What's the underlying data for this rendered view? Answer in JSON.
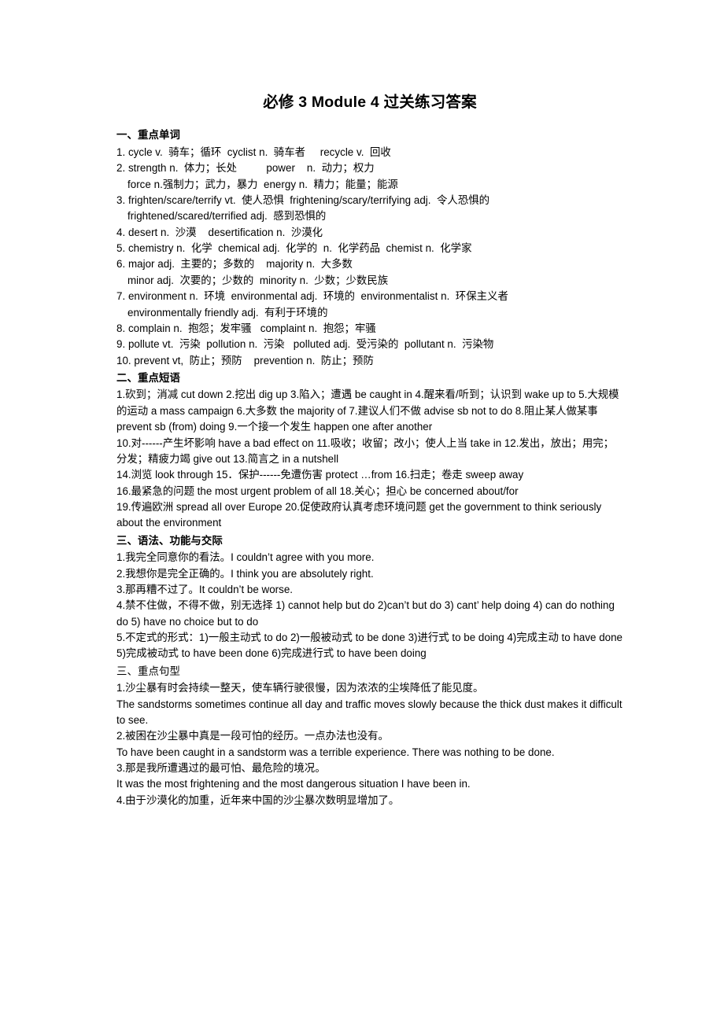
{
  "document": {
    "title": "必修 3 Module 4  过关练习答案"
  },
  "sections": [
    {
      "id": "key-words",
      "heading": "一、重点单词",
      "heading_bold": true,
      "lines": [
        {
          "indent": false,
          "text": "1. cycle v.  骑车；循环  cyclist n.  骑车者     recycle v.  回收"
        },
        {
          "indent": false,
          "text": "2. strength n.  体力；长处          power    n.  动力；权力"
        },
        {
          "indent": true,
          "text": "force n.强制力；武力，暴力  energy n.  精力；能量；能源"
        },
        {
          "indent": false,
          "text": "3. frighten/scare/terrify vt.  使人恐惧  frightening/scary/terrifying adj.  令人恐惧的"
        },
        {
          "indent": true,
          "text": "frightened/scared/terrified adj.  感到恐惧的"
        },
        {
          "indent": false,
          "text": "4. desert n.  沙漠    desertification n.  沙漠化"
        },
        {
          "indent": false,
          "text": "5. chemistry n.  化学  chemical adj.  化学的  n.  化学药品  chemist n.  化学家"
        },
        {
          "indent": false,
          "text": "6. major adj.  主要的；多数的    majority n.  大多数"
        },
        {
          "indent": true,
          "text": "minor adj.  次要的；少数的  minority n.  少数；少数民族"
        },
        {
          "indent": false,
          "text": "7. environment n.  环境  environmental adj.  环境的  environmentalist n.  环保主义者"
        },
        {
          "indent": true,
          "text": "environmentally friendly adj.  有利于环境的"
        },
        {
          "indent": false,
          "text": "8. complain n.  抱怨；发牢骚   complaint n.  抱怨；牢骚"
        },
        {
          "indent": false,
          "text": "9. pollute vt.  污染  pollution n.  污染   polluted adj.  受污染的  pollutant n.  污染物"
        },
        {
          "indent": false,
          "text": "10. prevent vt,  防止；预防    prevention n.  防止；预防"
        }
      ],
      "paragraphs": []
    },
    {
      "id": "key-phrases",
      "heading": "二、重点短语",
      "heading_bold": true,
      "lines": [],
      "paragraphs": [
        "1.砍到；消减 cut down    2.挖出 dig up    3.陷入；遭遇 be caught in     4.醒来看/听到；认识到 wake up to 5.大规模的运动 a mass campaign 6.大多数 the majority of    7.建议人们不做 advise sb not to do 8.阻止某人做某事  prevent sb (from) doing    9.一个接一个发生  happen one after another",
        "10.对------产生坏影响 have a bad effect on    11.吸收；收留；改小；使人上当 take in    12.发出，放出；用完；分发；精疲力竭 give out    13.简言之 in a nutshell",
        "14.浏览 look through     15．保护------免遭伤害 protect …from    16.扫走；卷走 sweep away",
        "16.最紧急的问题 the most urgent problem of all        18.关心；担心 be concerned about/for",
        "19.传遍欧洲 spread all over Europe    20.促使政府认真考虑环境问题    get the government to think seriously about the environment"
      ]
    },
    {
      "id": "grammar-function",
      "heading": "三、语法、功能与交际",
      "heading_bold": true,
      "lines": [],
      "paragraphs": [
        "1.我完全同意你的看法。I couldn’t agree with you more.",
        "2.我想你是完全正确的。I think you are absolutely right.",
        "3.那再糟不过了。It couldn’t be worse.",
        "4.禁不住做，不得不做，别无选择  1) cannot help but do    2)can’t but do   3) cant’ help doing     4) can do nothing do     5) have no choice but to do",
        "5.不定式的形式：1)一般主动式 to do   2)一般被动式 to be done    3)进行式 to be doing  4)完成主动 to have done    5)完成被动式 to have been done    6)完成进行式 to have been doing"
      ]
    },
    {
      "id": "key-sentences",
      "heading": "三、重点句型",
      "heading_bold": false,
      "lines": [],
      "paragraphs": [
        "1.沙尘暴有时会持续一整天，使车辆行驶很慢，因为浓浓的尘埃降低了能见度。",
        "The sandstorms sometimes continue all day and traffic moves slowly because the thick dust makes it difficult to see.",
        "2.被困在沙尘暴中真是一段可怕的经历。一点办法也没有。",
        "To have been caught in a sandstorm was a terrible experience. There was nothing to be done.",
        "3.那是我所遭遇过的最可怕、最危险的境况。",
        "It was the most frightening and the most dangerous situation I have been in.",
        "4.由于沙漠化的加重，近年来中国的沙尘暴次数明显增加了。"
      ]
    }
  ]
}
